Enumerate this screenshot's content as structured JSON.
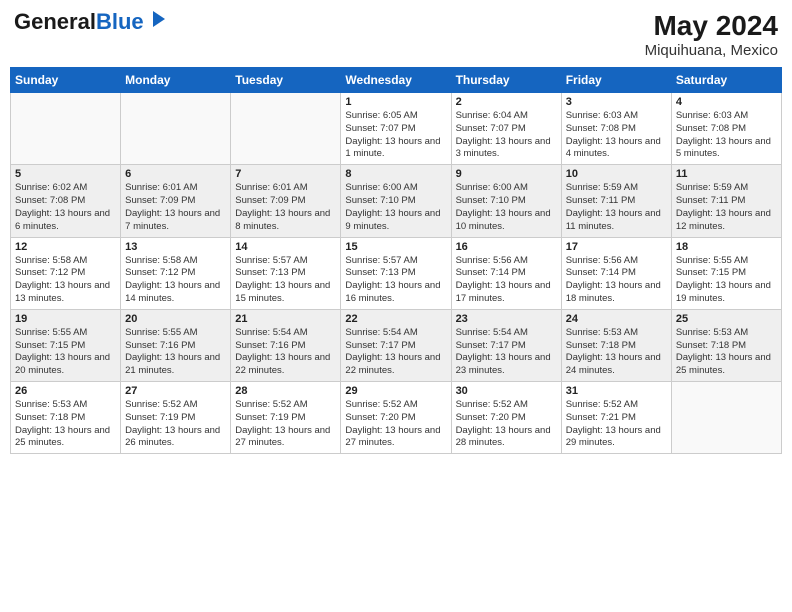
{
  "header": {
    "logo_line1": "General",
    "logo_line2": "Blue",
    "title": "May 2024",
    "subtitle": "Miquihuana, Mexico"
  },
  "days_of_week": [
    "Sunday",
    "Monday",
    "Tuesday",
    "Wednesday",
    "Thursday",
    "Friday",
    "Saturday"
  ],
  "weeks": [
    [
      {
        "day": "",
        "sunrise": "",
        "sunset": "",
        "daylight": ""
      },
      {
        "day": "",
        "sunrise": "",
        "sunset": "",
        "daylight": ""
      },
      {
        "day": "",
        "sunrise": "",
        "sunset": "",
        "daylight": ""
      },
      {
        "day": "1",
        "sunrise": "Sunrise: 6:05 AM",
        "sunset": "Sunset: 7:07 PM",
        "daylight": "Daylight: 13 hours and 1 minute."
      },
      {
        "day": "2",
        "sunrise": "Sunrise: 6:04 AM",
        "sunset": "Sunset: 7:07 PM",
        "daylight": "Daylight: 13 hours and 3 minutes."
      },
      {
        "day": "3",
        "sunrise": "Sunrise: 6:03 AM",
        "sunset": "Sunset: 7:08 PM",
        "daylight": "Daylight: 13 hours and 4 minutes."
      },
      {
        "day": "4",
        "sunrise": "Sunrise: 6:03 AM",
        "sunset": "Sunset: 7:08 PM",
        "daylight": "Daylight: 13 hours and 5 minutes."
      }
    ],
    [
      {
        "day": "5",
        "sunrise": "Sunrise: 6:02 AM",
        "sunset": "Sunset: 7:08 PM",
        "daylight": "Daylight: 13 hours and 6 minutes."
      },
      {
        "day": "6",
        "sunrise": "Sunrise: 6:01 AM",
        "sunset": "Sunset: 7:09 PM",
        "daylight": "Daylight: 13 hours and 7 minutes."
      },
      {
        "day": "7",
        "sunrise": "Sunrise: 6:01 AM",
        "sunset": "Sunset: 7:09 PM",
        "daylight": "Daylight: 13 hours and 8 minutes."
      },
      {
        "day": "8",
        "sunrise": "Sunrise: 6:00 AM",
        "sunset": "Sunset: 7:10 PM",
        "daylight": "Daylight: 13 hours and 9 minutes."
      },
      {
        "day": "9",
        "sunrise": "Sunrise: 6:00 AM",
        "sunset": "Sunset: 7:10 PM",
        "daylight": "Daylight: 13 hours and 10 minutes."
      },
      {
        "day": "10",
        "sunrise": "Sunrise: 5:59 AM",
        "sunset": "Sunset: 7:11 PM",
        "daylight": "Daylight: 13 hours and 11 minutes."
      },
      {
        "day": "11",
        "sunrise": "Sunrise: 5:59 AM",
        "sunset": "Sunset: 7:11 PM",
        "daylight": "Daylight: 13 hours and 12 minutes."
      }
    ],
    [
      {
        "day": "12",
        "sunrise": "Sunrise: 5:58 AM",
        "sunset": "Sunset: 7:12 PM",
        "daylight": "Daylight: 13 hours and 13 minutes."
      },
      {
        "day": "13",
        "sunrise": "Sunrise: 5:58 AM",
        "sunset": "Sunset: 7:12 PM",
        "daylight": "Daylight: 13 hours and 14 minutes."
      },
      {
        "day": "14",
        "sunrise": "Sunrise: 5:57 AM",
        "sunset": "Sunset: 7:13 PM",
        "daylight": "Daylight: 13 hours and 15 minutes."
      },
      {
        "day": "15",
        "sunrise": "Sunrise: 5:57 AM",
        "sunset": "Sunset: 7:13 PM",
        "daylight": "Daylight: 13 hours and 16 minutes."
      },
      {
        "day": "16",
        "sunrise": "Sunrise: 5:56 AM",
        "sunset": "Sunset: 7:14 PM",
        "daylight": "Daylight: 13 hours and 17 minutes."
      },
      {
        "day": "17",
        "sunrise": "Sunrise: 5:56 AM",
        "sunset": "Sunset: 7:14 PM",
        "daylight": "Daylight: 13 hours and 18 minutes."
      },
      {
        "day": "18",
        "sunrise": "Sunrise: 5:55 AM",
        "sunset": "Sunset: 7:15 PM",
        "daylight": "Daylight: 13 hours and 19 minutes."
      }
    ],
    [
      {
        "day": "19",
        "sunrise": "Sunrise: 5:55 AM",
        "sunset": "Sunset: 7:15 PM",
        "daylight": "Daylight: 13 hours and 20 minutes."
      },
      {
        "day": "20",
        "sunrise": "Sunrise: 5:55 AM",
        "sunset": "Sunset: 7:16 PM",
        "daylight": "Daylight: 13 hours and 21 minutes."
      },
      {
        "day": "21",
        "sunrise": "Sunrise: 5:54 AM",
        "sunset": "Sunset: 7:16 PM",
        "daylight": "Daylight: 13 hours and 22 minutes."
      },
      {
        "day": "22",
        "sunrise": "Sunrise: 5:54 AM",
        "sunset": "Sunset: 7:17 PM",
        "daylight": "Daylight: 13 hours and 22 minutes."
      },
      {
        "day": "23",
        "sunrise": "Sunrise: 5:54 AM",
        "sunset": "Sunset: 7:17 PM",
        "daylight": "Daylight: 13 hours and 23 minutes."
      },
      {
        "day": "24",
        "sunrise": "Sunrise: 5:53 AM",
        "sunset": "Sunset: 7:18 PM",
        "daylight": "Daylight: 13 hours and 24 minutes."
      },
      {
        "day": "25",
        "sunrise": "Sunrise: 5:53 AM",
        "sunset": "Sunset: 7:18 PM",
        "daylight": "Daylight: 13 hours and 25 minutes."
      }
    ],
    [
      {
        "day": "26",
        "sunrise": "Sunrise: 5:53 AM",
        "sunset": "Sunset: 7:18 PM",
        "daylight": "Daylight: 13 hours and 25 minutes."
      },
      {
        "day": "27",
        "sunrise": "Sunrise: 5:52 AM",
        "sunset": "Sunset: 7:19 PM",
        "daylight": "Daylight: 13 hours and 26 minutes."
      },
      {
        "day": "28",
        "sunrise": "Sunrise: 5:52 AM",
        "sunset": "Sunset: 7:19 PM",
        "daylight": "Daylight: 13 hours and 27 minutes."
      },
      {
        "day": "29",
        "sunrise": "Sunrise: 5:52 AM",
        "sunset": "Sunset: 7:20 PM",
        "daylight": "Daylight: 13 hours and 27 minutes."
      },
      {
        "day": "30",
        "sunrise": "Sunrise: 5:52 AM",
        "sunset": "Sunset: 7:20 PM",
        "daylight": "Daylight: 13 hours and 28 minutes."
      },
      {
        "day": "31",
        "sunrise": "Sunrise: 5:52 AM",
        "sunset": "Sunset: 7:21 PM",
        "daylight": "Daylight: 13 hours and 29 minutes."
      },
      {
        "day": "",
        "sunrise": "",
        "sunset": "",
        "daylight": ""
      }
    ]
  ]
}
